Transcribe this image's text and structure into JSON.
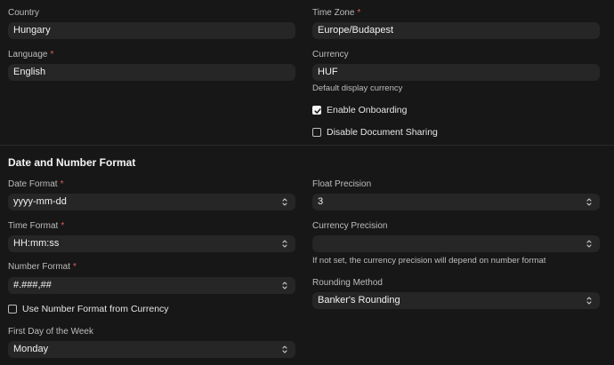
{
  "locale": {
    "country": {
      "label": "Country",
      "value": "Hungary"
    },
    "time_zone": {
      "label": "Time Zone",
      "value": "Europe/Budapest"
    },
    "language": {
      "label": "Language",
      "value": "English"
    },
    "currency": {
      "label": "Currency",
      "value": "HUF",
      "help": "Default display currency"
    },
    "enable_onboarding": {
      "label": "Enable Onboarding",
      "checked": true
    },
    "disable_document_sharing": {
      "label": "Disable Document Sharing",
      "checked": false
    }
  },
  "format_section": {
    "title": "Date and Number Format",
    "date_format": {
      "label": "Date Format",
      "value": "yyyy-mm-dd"
    },
    "time_format": {
      "label": "Time Format",
      "value": "HH:mm:ss"
    },
    "number_format": {
      "label": "Number Format",
      "value": "#.###,##"
    },
    "use_number_format_from_currency": {
      "label": "Use Number Format from Currency",
      "checked": false
    },
    "first_day_of_week": {
      "label": "First Day of the Week",
      "value": "Monday"
    },
    "float_precision": {
      "label": "Float Precision",
      "value": "3"
    },
    "currency_precision": {
      "label": "Currency Precision",
      "value": "",
      "help": "If not set, the currency precision will depend on number format"
    },
    "rounding_method": {
      "label": "Rounding Method",
      "value": "Banker's Rounding"
    }
  },
  "required_marker": "*",
  "icons": {
    "select_arrow": "chevron-up-down-icon",
    "checkmark": "check-icon"
  }
}
